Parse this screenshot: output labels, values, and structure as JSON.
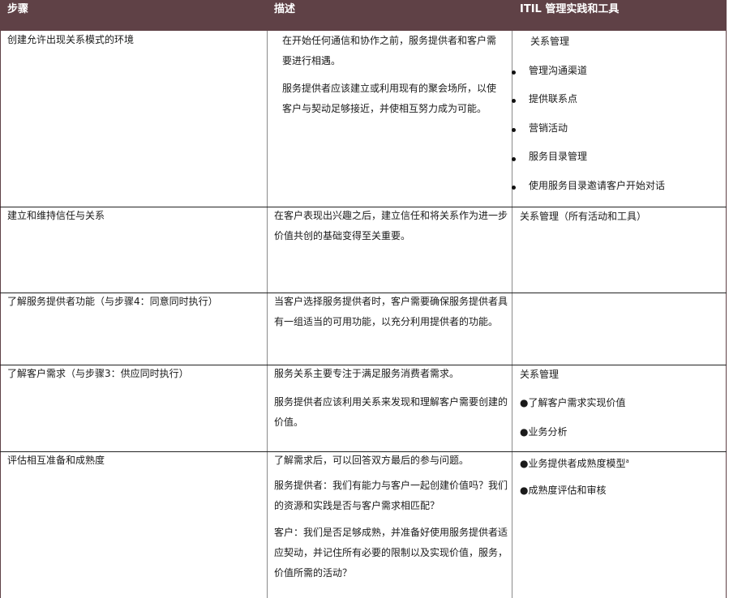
{
  "header": {
    "col1": "步骤",
    "col2": "描述",
    "col3": "ITIL 管理实践和工具"
  },
  "rows": [
    {
      "step": "创建允许出现关系模式的环境",
      "desc": [
        "在开始任何通信和协作之前，服务提供者和客户需要进行相遇。",
        "服务提供者应该建立或利用现有的聚会场所，以使客户与契动足够接近，并使相互努力成为可能。"
      ],
      "tools": [
        "关系管理",
        "管理沟通渠道",
        "提供联系点",
        "营销活动",
        "服务目录管理",
        "使用服务目录邀请客户开始对话"
      ]
    },
    {
      "step": "建立和维持信任与关系",
      "desc": [
        "在客户表现出兴趣之后，建立信任和将关系作为进一步价值共创的基础变得至关重要。"
      ],
      "tools": [
        "关系管理（所有活动和工具）"
      ]
    },
    {
      "step": "了解服务提供者功能（与步骤4：同意同时执行）",
      "desc": [
        "当客户选择服务提供者时，客户需要确保服务提供者具有一组适当的可用功能，以充分利用提供者的功能。"
      ],
      "tools": []
    },
    {
      "step": "了解客户需求（与步骤3：供应同时执行）",
      "desc": [
        "服务关系主要专注于满足服务消费者需求。",
        "服务提供者应该利用关系来发现和理解客户需要创建的价值。"
      ],
      "tools": [
        "关系管理",
        "●了解客户需求实现价值",
        "●业务分析"
      ]
    },
    {
      "step": "评估相互准备和成熟度",
      "desc": [
        "了解需求后，可以回答双方最后的参与问题。",
        "服务提供者：我们有能力与客户一起创建价值吗？我们的资源和实践是否与客户需求相匹配？",
        "客户：我们是否足够成熟，并准备好使用服务提供者适应契动，并记住所有必要的限制以及实现价值，服务，价值所需的活动？"
      ],
      "tools": [
        "●业务提供者成熟度模型",
        "●成熟度评估和审核"
      ],
      "tools_note": "a"
    }
  ]
}
